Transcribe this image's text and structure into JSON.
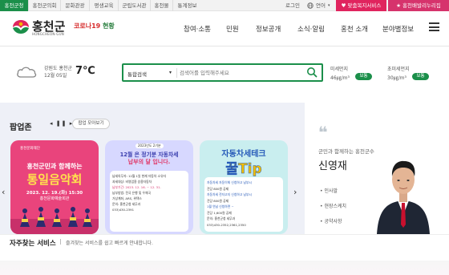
{
  "topbar": {
    "tabs": [
      "홍천군청",
      "홍천군의회",
      "문화관광",
      "평생교육",
      "군립도서관",
      "홍천몰",
      "통계정보"
    ],
    "login": "로그인",
    "language": "언어",
    "welfare": "맞춤복지서비스",
    "online": "홍천배발리누리집"
  },
  "header": {
    "logo_text": "홍천군",
    "logo_sub": "HONGCHEON-GUN",
    "covid_prefix": "코로나19",
    "covid_suffix": "현황",
    "nav": [
      "참여·소통",
      "민원",
      "정보공개",
      "소식·알림",
      "홍천 소개",
      "분야별정보"
    ]
  },
  "weather": {
    "location": "강원도 홍천군",
    "date": "12월 05일",
    "temperature": "7℃"
  },
  "search": {
    "scope": "통합검색",
    "placeholder": "검색어를 입력해주세요"
  },
  "dust": {
    "fine_label": "미세먼지",
    "fine_value": "46㎍/m³",
    "fine_status": "보통",
    "ultra_label": "초미세먼지",
    "ultra_value": "30㎍/m³",
    "ultra_status": "보통"
  },
  "popup": {
    "title": "팝업존",
    "pause": "◂ ❚❚ ▸",
    "more": "팝업 모아보기",
    "card1": {
      "org": "홍천문화재단",
      "line1": "홍천군민과 함께하는",
      "line2": "통일음악회",
      "date": "2023. 12. 19.(화) 15:30",
      "venue": "홍천문화예술회관"
    },
    "card2": {
      "tag": "2023년도 2기분",
      "line1": "12월 은 정기분 자동차세",
      "line2": "납부의 달 입니다.",
      "details": [
        "납세의무자: 12월 1일 현재 자동차 소유자",
        "과세대상: 비영업용 승용자동차",
        "납부기간: 2023. 12. 16. ~ 12. 31.",
        "납부방법: 전국 은행 및 우체국",
        "가상계좌, ARS, 위택스",
        "문의: 홍천군청 세무과",
        "033)430-2391"
      ]
    },
    "card3": {
      "line1": "자동차세테크",
      "line2": "꿀Tip",
      "details": [
        "자동차세 자동이체 신청하고 납부시",
        "건당 800원 공제",
        "자동차세 전자고지 신청하고 납부시",
        "건당 800원 공제",
        "1월 연납 신청하면 ~",
        "건당 1,600원 공제",
        "문의: 홍천군청 세무과",
        "033)430-2352,2361,2350"
      ]
    }
  },
  "mayor": {
    "quote_mark": "❝",
    "subtitle": "군민과 함께하는 홍천군수",
    "name": "신영재",
    "links": [
      "인사말",
      "현장스케치",
      "공약사항"
    ]
  },
  "bottom": {
    "title": "자주찾는 서비스",
    "subtitle": "즐겨찾는 서비스를 쉽고 빠르게 안내합니다."
  },
  "colors": {
    "brand_green": "#1b8f4a",
    "alert_red": "#e0245e"
  }
}
